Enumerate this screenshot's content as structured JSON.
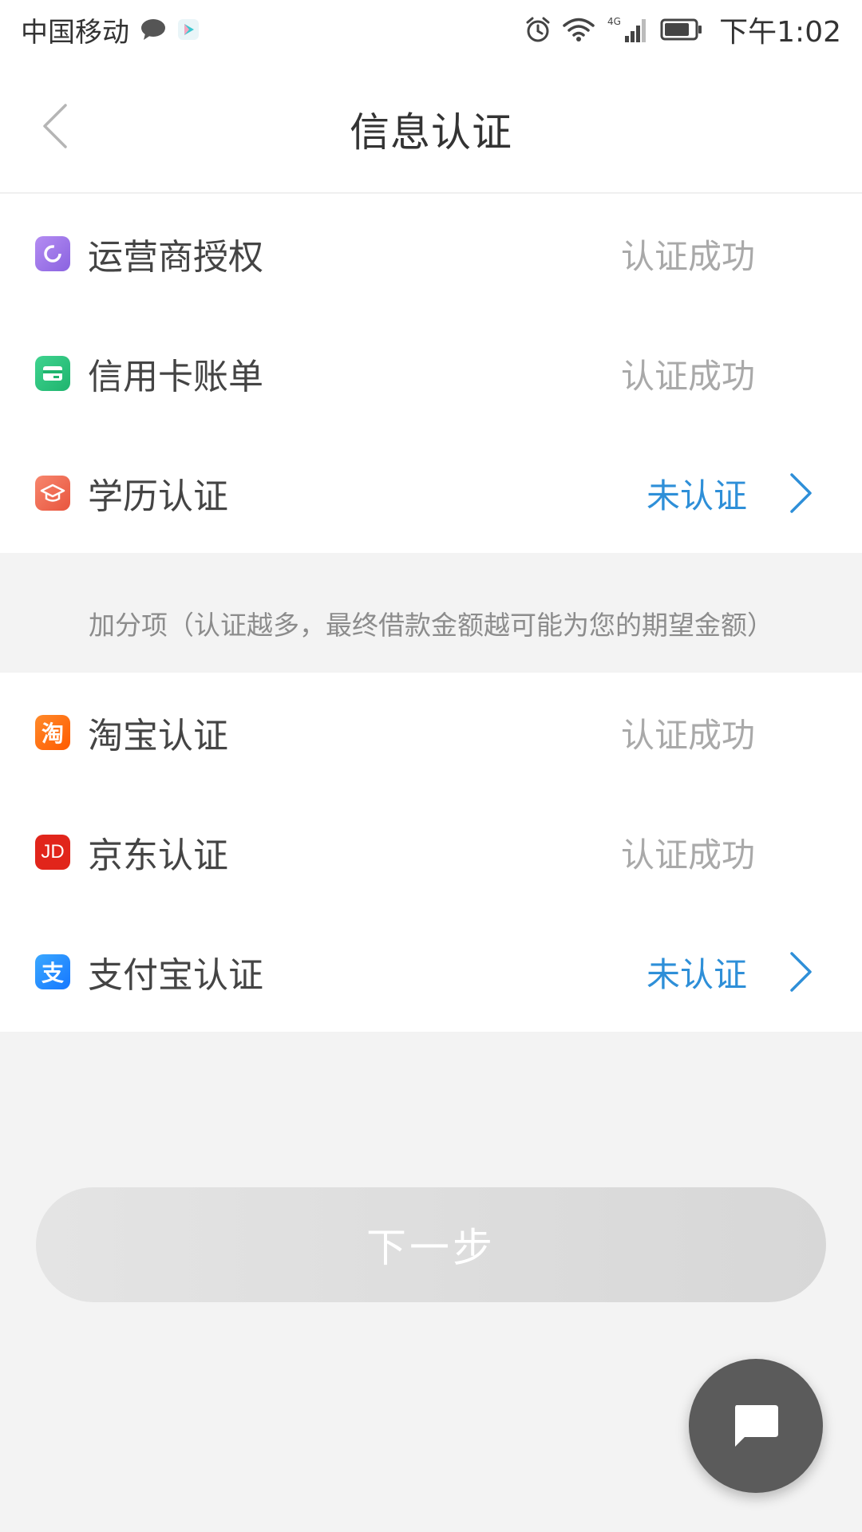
{
  "status_bar": {
    "carrier": "中国移动",
    "network": "4G",
    "time": "下午1:02"
  },
  "header": {
    "title": "信息认证"
  },
  "section_required": {
    "items": [
      {
        "label": "运营商授权",
        "status": "认证成功",
        "icon": "operator-icon",
        "icon_color": "#9b74e8"
      },
      {
        "label": "信用卡账单",
        "status": "认证成功",
        "icon": "credit-card-icon",
        "icon_color": "#2ec27e"
      },
      {
        "label": "学历认证",
        "status": "未认证",
        "icon": "graduation-cap-icon",
        "icon_color": "#f06a4f"
      }
    ]
  },
  "bonus_hint": "加分项（认证越多，最终借款金额越可能为您的期望金额）",
  "section_bonus": {
    "items": [
      {
        "label": "淘宝认证",
        "status": "认证成功",
        "icon": "taobao-icon",
        "icon_text": "淘",
        "icon_color": "#ff6a00"
      },
      {
        "label": "京东认证",
        "status": "认证成功",
        "icon": "jd-icon",
        "icon_text": "JD",
        "icon_color": "#e1251b"
      },
      {
        "label": "支付宝认证",
        "status": "未认证",
        "icon": "alipay-icon",
        "icon_text": "支",
        "icon_color": "#1e90ff"
      }
    ]
  },
  "next_button": {
    "label": "下一步"
  },
  "colors": {
    "pending": "#2e8fd8",
    "done": "#a9a9a9",
    "button_disabled": "#dcdcdc",
    "fab": "#5b5b5b"
  }
}
